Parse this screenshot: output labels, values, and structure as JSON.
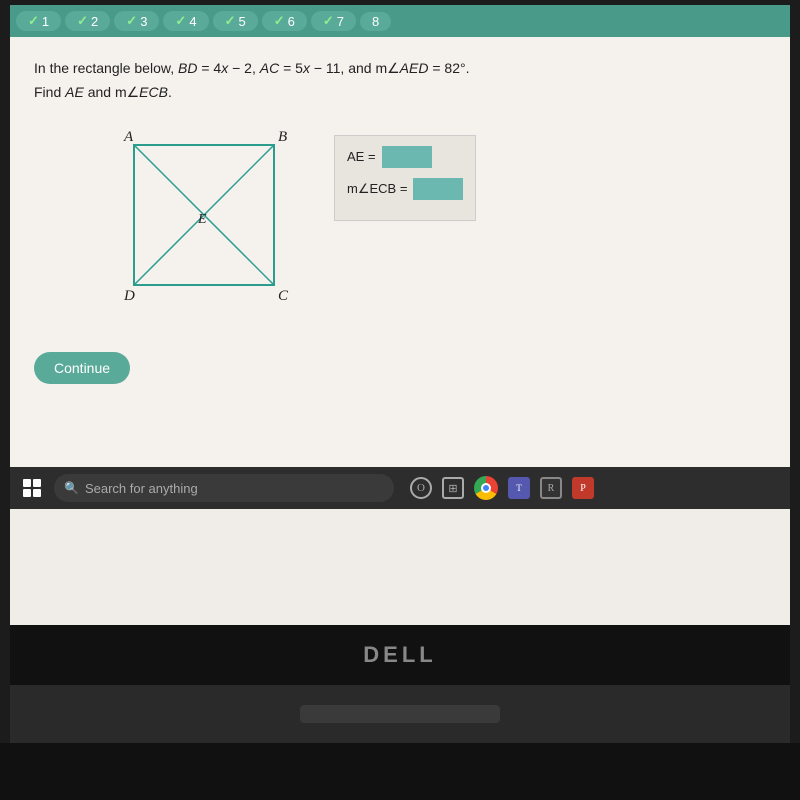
{
  "tabs": [
    {
      "label": "1",
      "checked": true
    },
    {
      "label": "2",
      "checked": true
    },
    {
      "label": "3",
      "checked": true
    },
    {
      "label": "4",
      "checked": true
    },
    {
      "label": "5",
      "checked": true
    },
    {
      "label": "6",
      "checked": true
    },
    {
      "label": "7",
      "checked": true
    },
    {
      "label": "8",
      "checked": false
    }
  ],
  "problem": {
    "line1": "In the rectangle below, BD = 4x − 2, AC = 5x − 11, and m∠AED = 82°.",
    "line2": "Find AE and m∠ECB.",
    "diagram": {
      "vertices": {
        "A": "top-left",
        "B": "top-right",
        "D": "bottom-left",
        "C": "bottom-right",
        "E": "center"
      },
      "labels": {
        "A": "A",
        "B": "B",
        "C": "C",
        "D": "D",
        "E": "E"
      }
    }
  },
  "answers": {
    "ae_label": "AE =",
    "ecb_label": "m∠ECB ="
  },
  "buttons": {
    "continue": "Continue"
  },
  "taskbar": {
    "search_placeholder": "Search for anything"
  },
  "dell_logo": "DELL",
  "colors": {
    "teal": "#5aaa9a",
    "tab_bg": "#4a9a8a",
    "screen_bg": "#f5f2ee"
  }
}
